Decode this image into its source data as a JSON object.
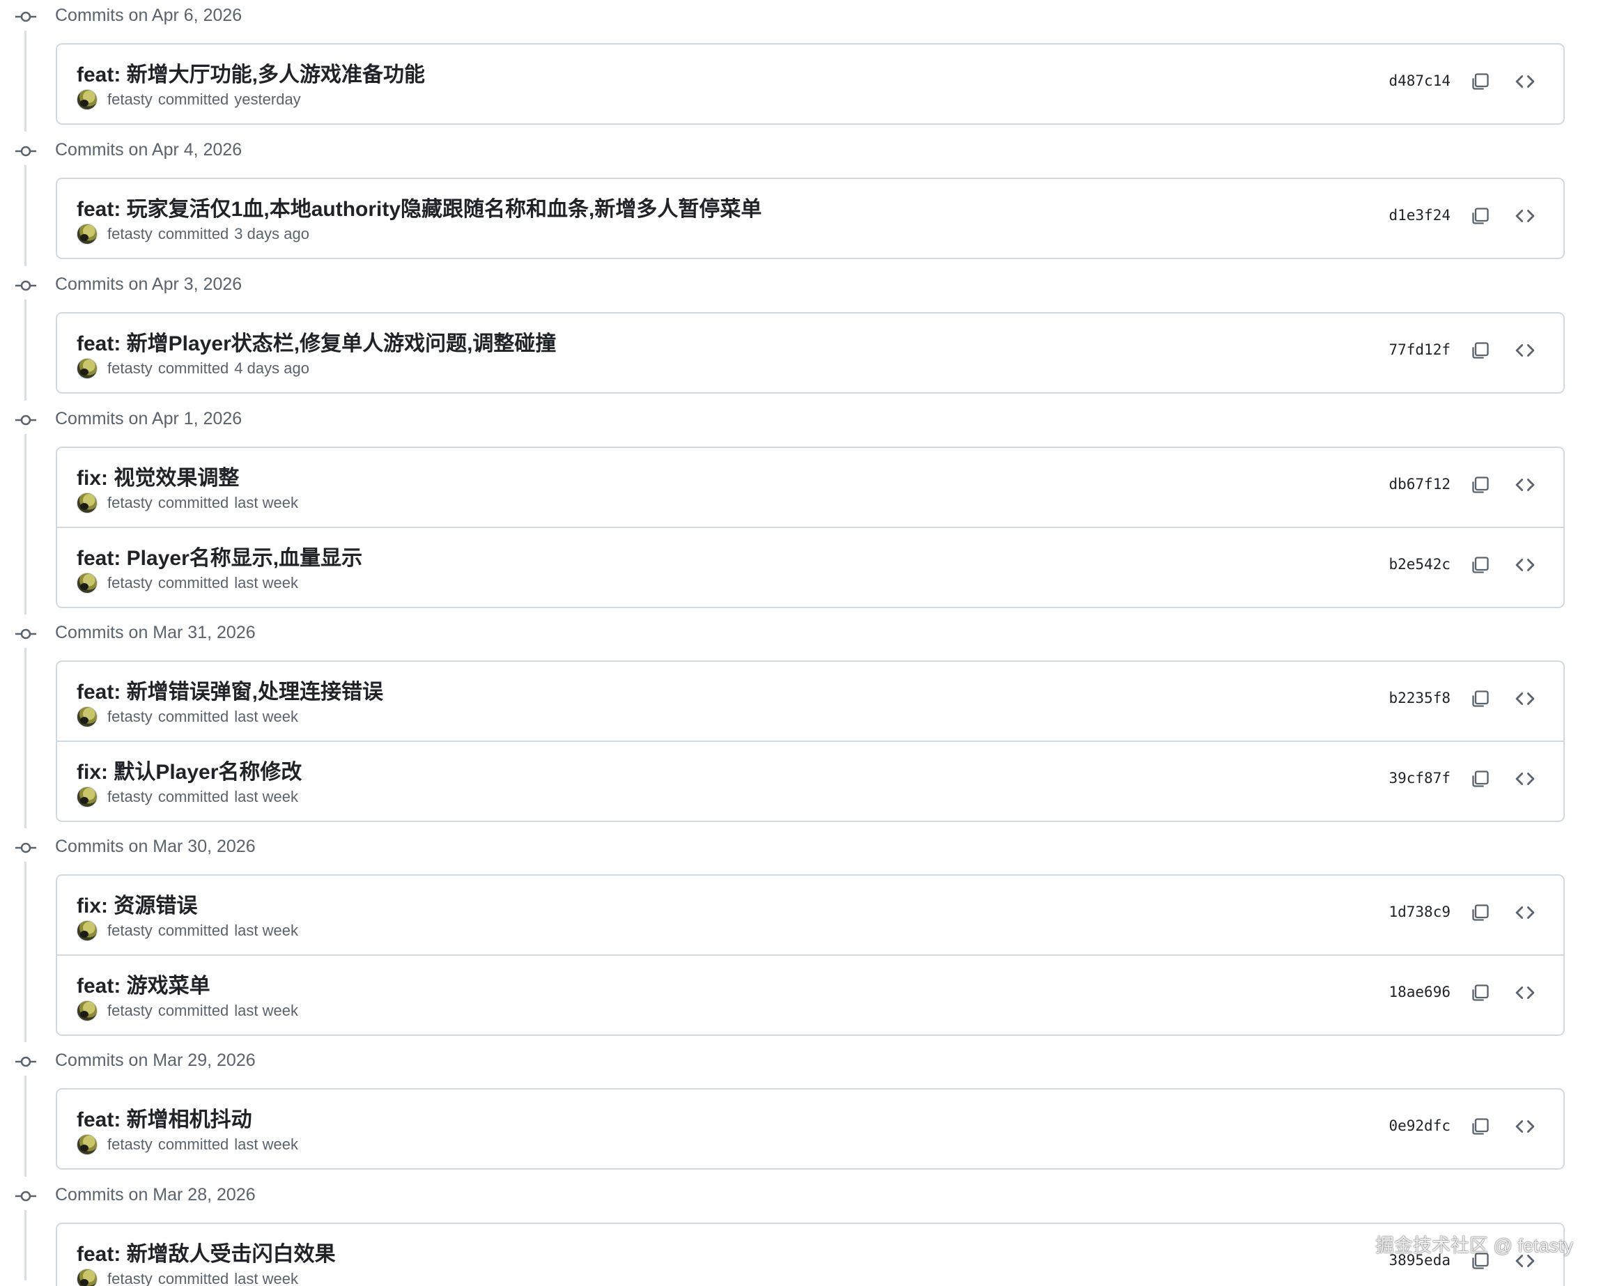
{
  "colors": {
    "text_primary": "#1f2328",
    "text_muted": "#59636e",
    "border": "#d1d9e0",
    "timeline": "#d8dee4"
  },
  "icons": {
    "timeline_node": "git-commit-icon",
    "copy": "copy-icon",
    "browse": "code-icon"
  },
  "groups": [
    {
      "header": "Commits on Apr 6, 2026",
      "commits": [
        {
          "title": "feat: 新增大厅功能,多人游戏准备功能",
          "author": "fetasty",
          "action": "committed",
          "time": "yesterday",
          "sha": "d487c14"
        }
      ]
    },
    {
      "header": "Commits on Apr 4, 2026",
      "commits": [
        {
          "title": "feat: 玩家复活仅1血,本地authority隐藏跟随名称和血条,新增多人暂停菜单",
          "author": "fetasty",
          "action": "committed",
          "time": "3 days ago",
          "sha": "d1e3f24"
        }
      ]
    },
    {
      "header": "Commits on Apr 3, 2026",
      "commits": [
        {
          "title": "feat: 新增Player状态栏,修复单人游戏问题,调整碰撞",
          "author": "fetasty",
          "action": "committed",
          "time": "4 days ago",
          "sha": "77fd12f"
        }
      ]
    },
    {
      "header": "Commits on Apr 1, 2026",
      "commits": [
        {
          "title": "fix: 视觉效果调整",
          "author": "fetasty",
          "action": "committed",
          "time": "last week",
          "sha": "db67f12"
        },
        {
          "title": "feat: Player名称显示,血量显示",
          "author": "fetasty",
          "action": "committed",
          "time": "last week",
          "sha": "b2e542c"
        }
      ]
    },
    {
      "header": "Commits on Mar 31, 2026",
      "commits": [
        {
          "title": "feat: 新增错误弹窗,处理连接错误",
          "author": "fetasty",
          "action": "committed",
          "time": "last week",
          "sha": "b2235f8"
        },
        {
          "title": "fix: 默认Player名称修改",
          "author": "fetasty",
          "action": "committed",
          "time": "last week",
          "sha": "39cf87f"
        }
      ]
    },
    {
      "header": "Commits on Mar 30, 2026",
      "commits": [
        {
          "title": "fix: 资源错误",
          "author": "fetasty",
          "action": "committed",
          "time": "last week",
          "sha": "1d738c9"
        },
        {
          "title": "feat: 游戏菜单",
          "author": "fetasty",
          "action": "committed",
          "time": "last week",
          "sha": "18ae696"
        }
      ]
    },
    {
      "header": "Commits on Mar 29, 2026",
      "commits": [
        {
          "title": "feat: 新增相机抖动",
          "author": "fetasty",
          "action": "committed",
          "time": "last week",
          "sha": "0e92dfc"
        }
      ]
    },
    {
      "header": "Commits on Mar 28, 2026",
      "commits": [
        {
          "title": "feat: 新增敌人受击闪白效果",
          "author": "fetasty",
          "action": "committed",
          "time": "last week",
          "sha": "3895eda"
        }
      ]
    }
  ],
  "watermark": "掘金技术社区 @ fetasty"
}
